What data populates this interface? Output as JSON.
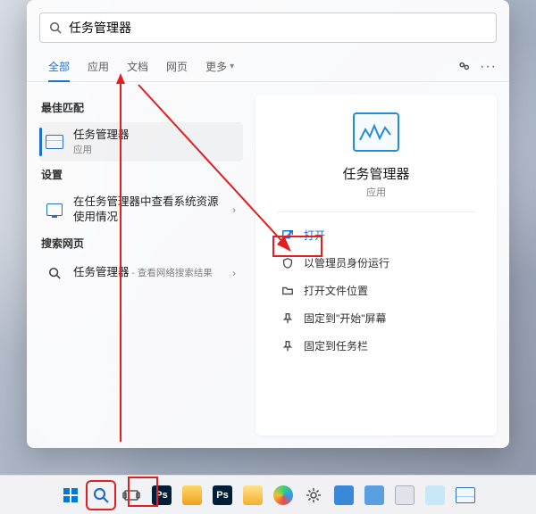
{
  "search": {
    "query": "任务管理器"
  },
  "tabs": {
    "all": "全部",
    "apps": "应用",
    "docs": "文档",
    "web": "网页",
    "more": "更多"
  },
  "left": {
    "best_label": "最佳匹配",
    "best_item": {
      "title": "任务管理器",
      "sub": "应用"
    },
    "settings_label": "设置",
    "settings_item": {
      "title": "在任务管理器中查看系统资源使用情况"
    },
    "web_label": "搜索网页",
    "web_item": {
      "title": "任务管理器",
      "sub": " - 查看网络搜索结果"
    }
  },
  "detail": {
    "title": "任务管理器",
    "sub": "应用",
    "actions": {
      "open": "打开",
      "admin": "以管理员身份运行",
      "loc": "打开文件位置",
      "pin_start": "固定到\"开始\"屏幕",
      "pin_task": "固定到任务栏"
    }
  },
  "colors": {
    "accent": "#1a6fd1",
    "highlight": "#e02020"
  }
}
